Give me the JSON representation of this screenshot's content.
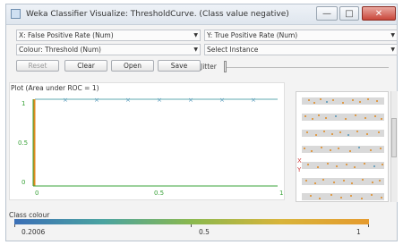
{
  "window": {
    "title": "Weka Classifier Visualize: ThresholdCurve. (Class value negative)",
    "min_symbol": "—",
    "max_symbol": "□",
    "close_symbol": "✕"
  },
  "controls": {
    "x_axis": "X: False Positive Rate (Num)",
    "y_axis": "Y: True Positive Rate (Num)",
    "colour": "Colour: Threshold (Num)",
    "instance": "Select Instance",
    "reset": "Reset",
    "clear": "Clear",
    "open": "Open",
    "save": "Save",
    "jitter": "Jitter",
    "dropdown_arrow": "▼"
  },
  "plot": {
    "title": "Plot (Area under ROC = 1)",
    "y_ticks": [
      "1",
      "0.5",
      "0"
    ],
    "x_ticks": [
      "0",
      "0.5",
      "1"
    ]
  },
  "side": {
    "x_marker": "X",
    "y_marker": "Y"
  },
  "legend": {
    "label": "Class colour",
    "min": "0.2006",
    "mid": "0.5",
    "max": "1"
  },
  "colors": {
    "orange_points": "#e08a1e",
    "blue_points": "#4f95b8",
    "axis_green": "#3aa33a",
    "teal_line": "#5fa9b0"
  }
}
